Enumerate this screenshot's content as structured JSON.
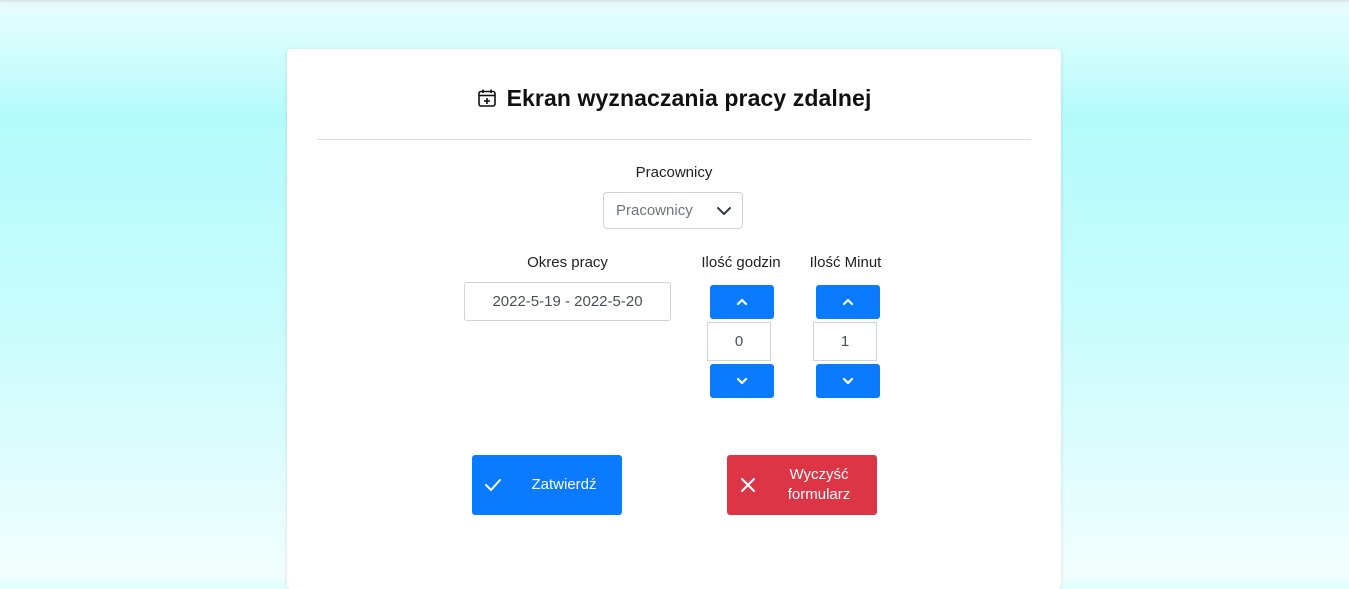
{
  "header": {
    "title": "Ekran wyznaczania pracy zdalnej",
    "icon": "calendar-plus-icon"
  },
  "employees": {
    "label": "Pracownicy",
    "selected": "Pracownicy"
  },
  "period": {
    "label": "Okres pracy",
    "value": "2022-5-19 - 2022-5-20"
  },
  "hours": {
    "label": "Ilość godzin",
    "value": "0"
  },
  "minutes": {
    "label": "Ilość Minut",
    "value": "1"
  },
  "actions": {
    "submit_label": "Zatwierdź",
    "clear_label_line1": "Wyczyść",
    "clear_label_line2": "formularz"
  },
  "colors": {
    "primary": "#0a7bff",
    "danger": "#dc3545"
  }
}
